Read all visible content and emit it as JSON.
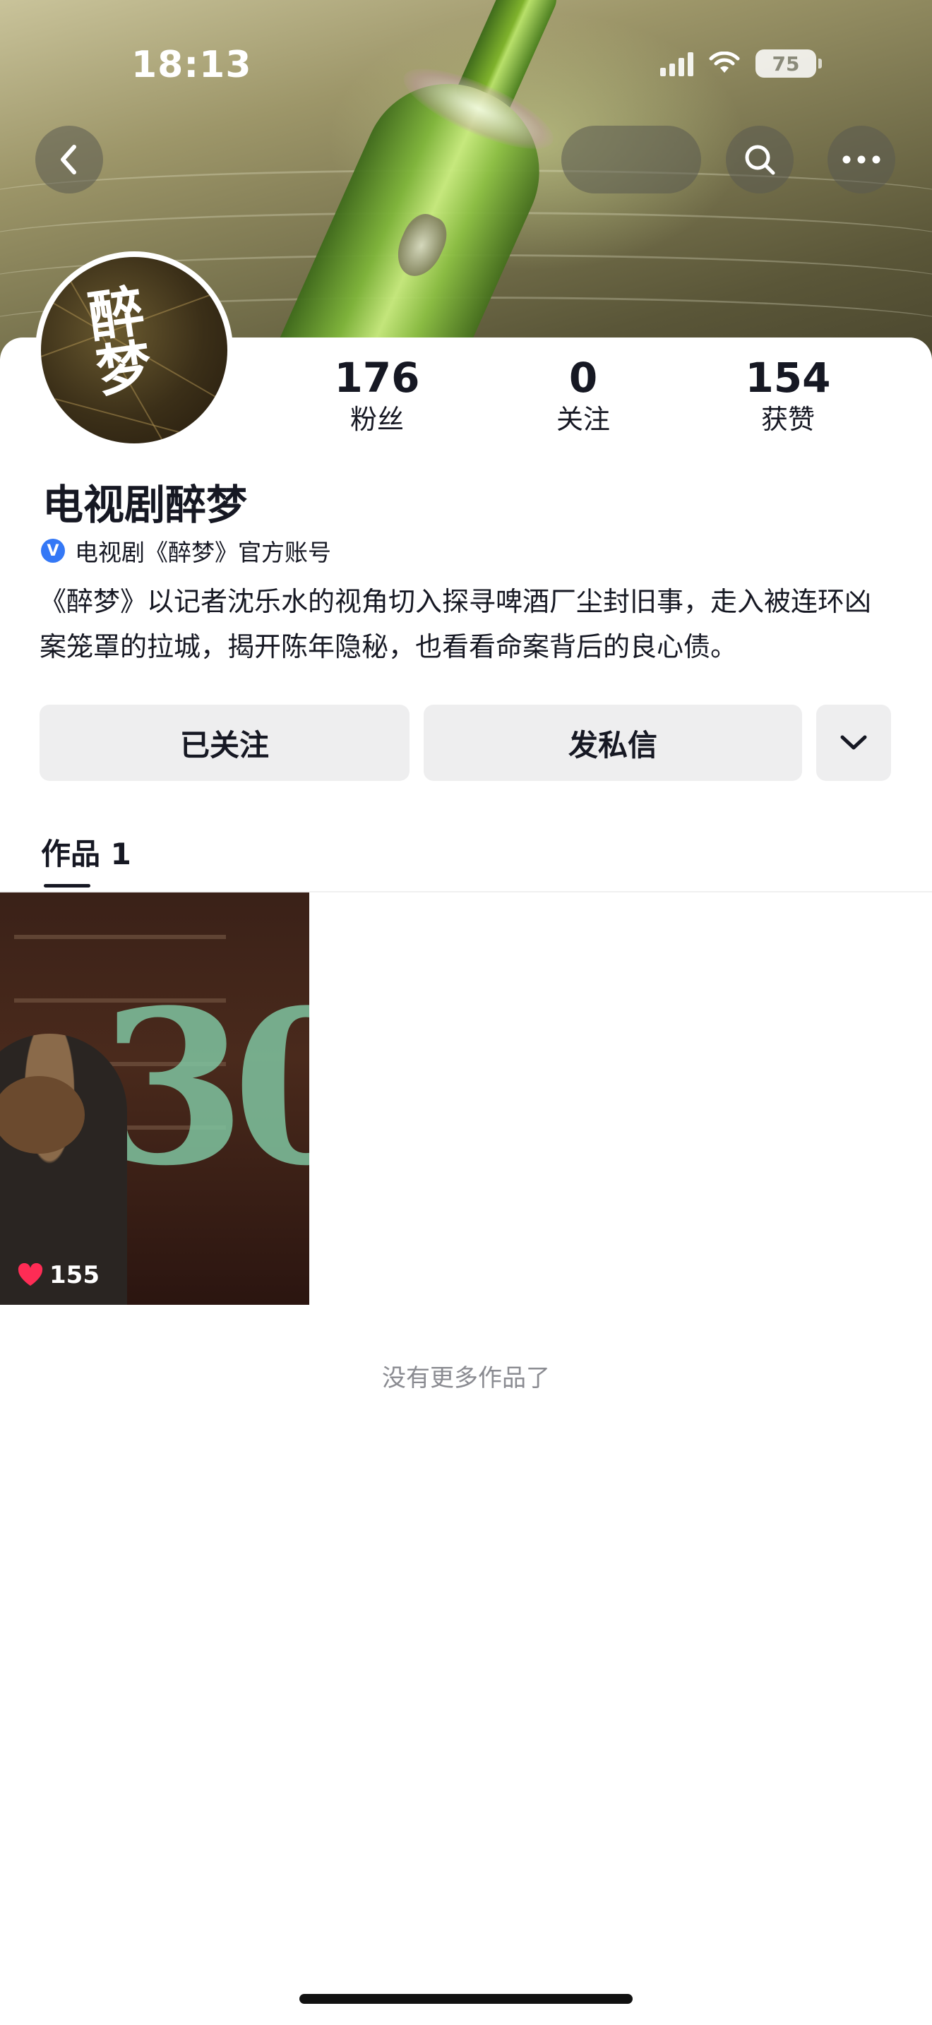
{
  "status_bar": {
    "time": "18:13",
    "battery": "75"
  },
  "profile": {
    "name": "电视剧醉梦",
    "avatar_text": "醉梦",
    "verified_label": "电视剧《醉梦》官方账号",
    "verified_badge": "V",
    "bio": "《醉梦》以记者沈乐水的视角切入探寻啤酒厂尘封旧事，走入被连环凶案笼罩的拉城，揭开陈年隐秘，也看看命案背后的良心债。",
    "stats": [
      {
        "value": "176",
        "label": "粉丝"
      },
      {
        "value": "0",
        "label": "关注"
      },
      {
        "value": "154",
        "label": "获赞"
      }
    ]
  },
  "actions": {
    "followed": "已关注",
    "message": "发私信"
  },
  "tabs": [
    {
      "label": "作品 1"
    }
  ],
  "works": [
    {
      "likes": "155",
      "title_text": "30"
    }
  ],
  "footer": {
    "end_text": "没有更多作品了"
  },
  "colors": {
    "accent": "#3478f6",
    "button_bg": "#eeeeef",
    "like": "#fe2c55"
  }
}
